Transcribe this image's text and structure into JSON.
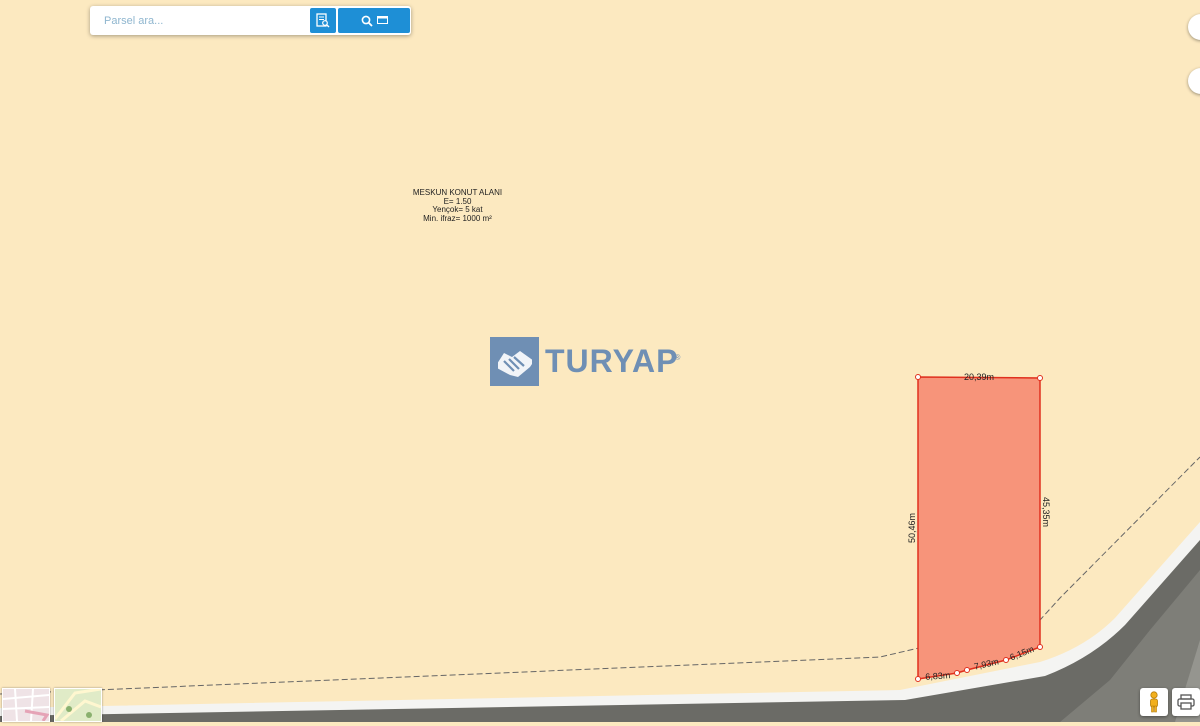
{
  "search": {
    "placeholder": "Parsel ara..."
  },
  "zone": {
    "line1": "MESKUN KONUT ALANI",
    "line2": "E= 1.50",
    "line3": "Yençok= 5 kat",
    "line4": "Min. ifraz= 1000 m²"
  },
  "logo": {
    "text": "TURYAP",
    "mark": "®"
  },
  "parcel": {
    "top": "20,39m",
    "right": "45,35m",
    "left": "50,46m",
    "bottom1": "6,83m",
    "bottom2": "7,93m",
    "bottom3": "6,15m"
  },
  "colors": {
    "zone_fill": "#fce9c0",
    "parcel_fill": "#f7947a",
    "parcel_stroke": "#e0301e",
    "button_blue": "#1e8fd6",
    "logo": "#6f8fb4"
  },
  "icons": {
    "doc_search": "document-search-icon",
    "search": "search-icon",
    "window": "window-icon",
    "street_view": "pegman-icon",
    "print": "printer-icon"
  }
}
